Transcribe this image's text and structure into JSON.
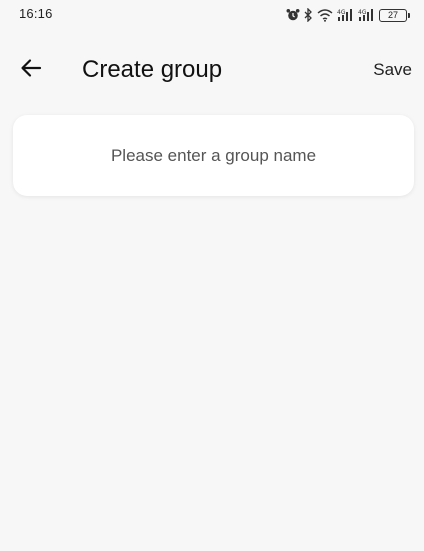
{
  "status_bar": {
    "time": "16:16",
    "battery_level": "27",
    "icons": [
      "alarm-icon",
      "bluetooth-icon",
      "wifi-icon",
      "signal-4g-icon",
      "signal-4g-icon",
      "battery-icon"
    ]
  },
  "header": {
    "title": "Create group",
    "save_label": "Save",
    "back_icon": "arrow-left-icon"
  },
  "form": {
    "group_name_value": "",
    "group_name_placeholder": "Please enter a group name"
  },
  "colors": {
    "background": "#f7f7f7",
    "card": "#ffffff",
    "text": "#111111"
  }
}
